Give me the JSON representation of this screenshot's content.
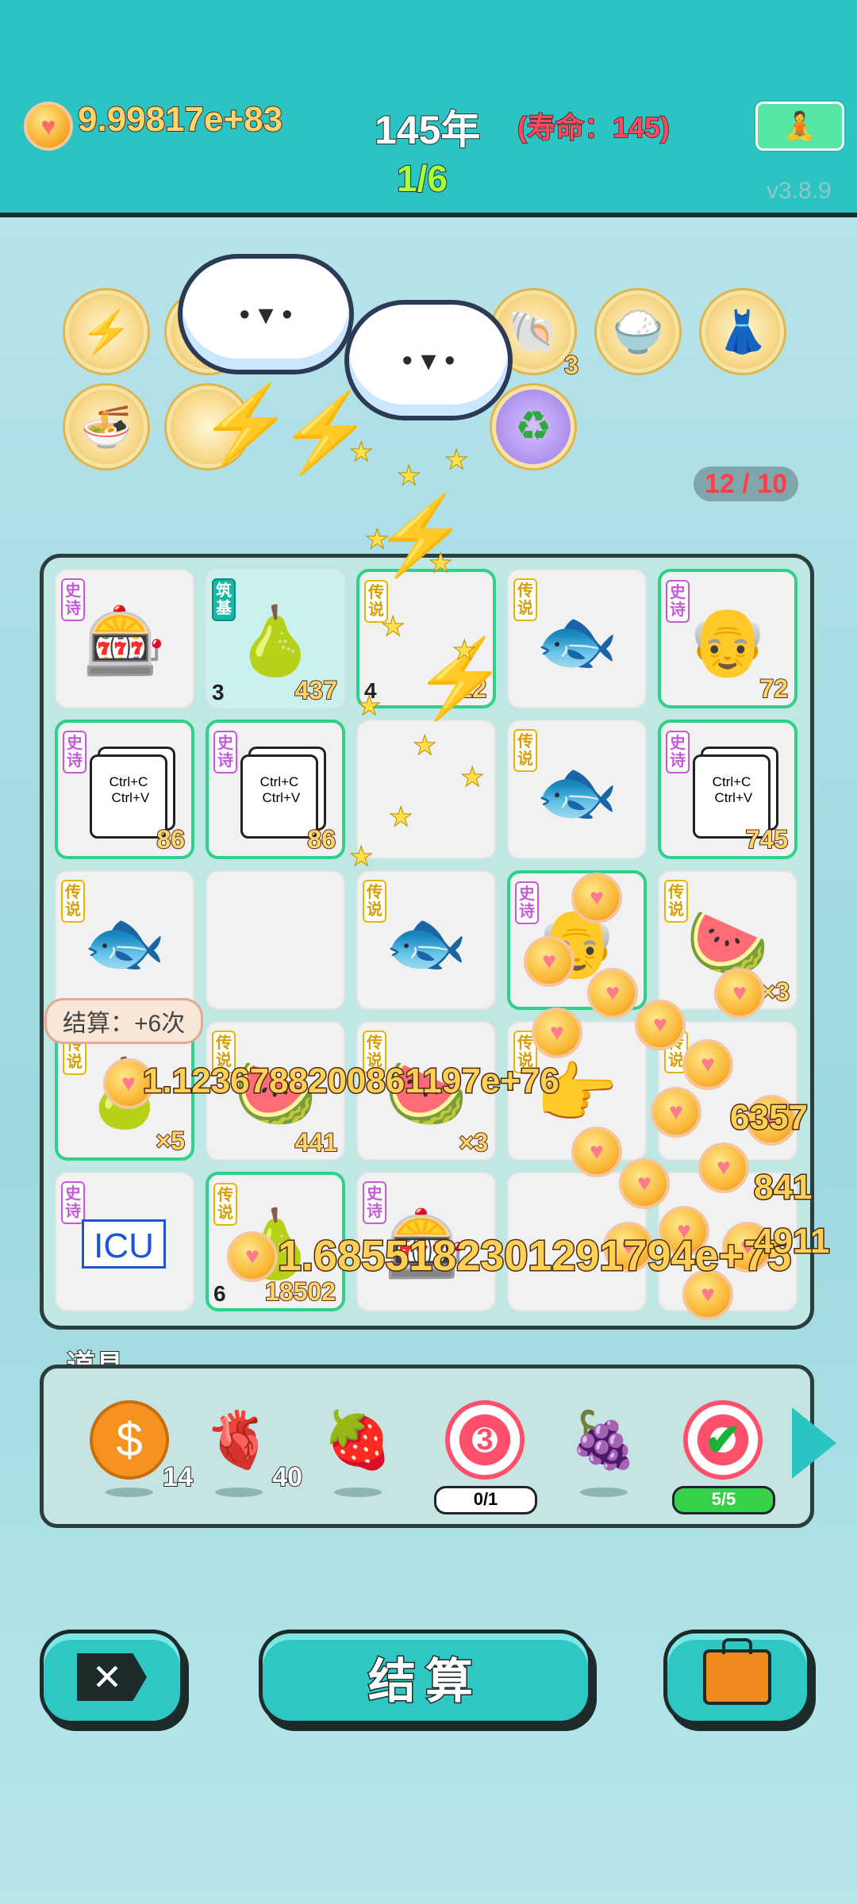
{
  "header": {
    "money": "9.99817e+83",
    "year": "145年",
    "lifespan": "(寿命：145)",
    "progress": "1/6",
    "version": "v3.8.9",
    "meditate_icon": "meditation-icon"
  },
  "buffs": {
    "row1": [
      {
        "icon": "lightning-icon",
        "glyph": "⚡",
        "count": ""
      },
      {
        "icon": "cloud-hidden-icon",
        "glyph": "",
        "count": ""
      },
      {
        "icon": "shell-icon",
        "glyph": "🐚",
        "count": "3"
      },
      {
        "icon": "rice-bowl-duo-icon",
        "glyph": "🍚",
        "count": ""
      },
      {
        "icon": "skirt-icon",
        "glyph": "👗",
        "count": ""
      }
    ],
    "row2": [
      {
        "icon": "rice-bowl-arrow-icon",
        "glyph": "🍜",
        "count": ""
      },
      {
        "icon": "recycle-icon",
        "glyph": "♻",
        "count": ""
      }
    ],
    "slots_counter": "12 / 10"
  },
  "board": {
    "cells": [
      {
        "tag": "史诗",
        "tag_style": "purple",
        "icon": "gacha-machine-icon",
        "glyph": "🎰",
        "value": "",
        "count": "",
        "style": "plain"
      },
      {
        "tag": "筑基",
        "tag_style": "teal",
        "icon": "longan-icon",
        "glyph": "🍐",
        "value": "437",
        "count": "3",
        "style": "teal"
      },
      {
        "tag": "传说",
        "tag_style": "yellow",
        "icon": "hidden-item-icon",
        "glyph": "",
        "value": "12",
        "count": "4",
        "style": "green"
      },
      {
        "tag": "传说",
        "tag_style": "yellow",
        "icon": "koi-fish-icon",
        "glyph": "🐟",
        "value": "",
        "count": "",
        "style": "plain"
      },
      {
        "tag": "史诗",
        "tag_style": "purple",
        "icon": "old-man-icon",
        "glyph": "👴",
        "value": "72",
        "count": "",
        "style": "green"
      },
      {
        "tag": "史诗",
        "tag_style": "purple",
        "icon": "ctrl-c-v-icon",
        "glyph": "",
        "value": "86",
        "count": "",
        "style": "green"
      },
      {
        "tag": "史诗",
        "tag_style": "purple",
        "icon": "ctrl-c-v-icon",
        "glyph": "",
        "value": "86",
        "count": "",
        "style": "green"
      },
      {
        "tag": "",
        "tag_style": "yellow",
        "icon": "hidden-item-icon",
        "glyph": "",
        "value": "",
        "count": "",
        "style": "plain"
      },
      {
        "tag": "传说",
        "tag_style": "yellow",
        "icon": "koi-fish-icon",
        "glyph": "🐟",
        "value": "",
        "count": "",
        "style": "plain"
      },
      {
        "tag": "史诗",
        "tag_style": "purple",
        "icon": "ctrl-c-v-icon",
        "glyph": "",
        "value": "745",
        "count": "",
        "style": "green"
      },
      {
        "tag": "传说",
        "tag_style": "yellow",
        "icon": "koi-fish-icon",
        "glyph": "🐟",
        "value": "",
        "count": "",
        "style": "plain"
      },
      {
        "tag": "",
        "tag_style": "yellow",
        "icon": "empty-slot",
        "glyph": "",
        "value": "",
        "count": "",
        "style": "plain"
      },
      {
        "tag": "传说",
        "tag_style": "yellow",
        "icon": "koi-fish-rainbow-icon",
        "glyph": "🐟",
        "value": "",
        "count": "",
        "style": "plain"
      },
      {
        "tag": "史诗",
        "tag_style": "purple",
        "icon": "old-man-icon",
        "glyph": "👴",
        "value": "",
        "count": "",
        "style": "green"
      },
      {
        "tag": "传说",
        "tag_style": "yellow",
        "icon": "watermelon-icon",
        "glyph": "🍉",
        "value": "×3",
        "count": "",
        "style": "plain"
      },
      {
        "tag": "传说",
        "tag_style": "yellow",
        "icon": "pear-icon",
        "glyph": "🍐",
        "value": "×5",
        "count": "",
        "style": "green"
      },
      {
        "tag": "传说",
        "tag_style": "yellow",
        "icon": "watermelon-icon",
        "glyph": "🍉",
        "value": "441",
        "count": "",
        "style": "plain"
      },
      {
        "tag": "传说",
        "tag_style": "yellow",
        "icon": "watermelon-icon",
        "glyph": "🍉",
        "value": "×3",
        "count": "",
        "style": "plain"
      },
      {
        "tag": "传说",
        "tag_style": "yellow",
        "icon": "pointer-hand-icon",
        "glyph": "👉",
        "value": "",
        "count": "",
        "style": "plain"
      },
      {
        "tag": "传说",
        "tag_style": "yellow",
        "icon": "hidden-item-icon",
        "glyph": "",
        "value": "",
        "count": "",
        "style": "plain"
      },
      {
        "tag": "史诗",
        "tag_style": "purple",
        "icon": "icu-icon",
        "glyph": "ICU",
        "value": "",
        "count": "",
        "style": "plain"
      },
      {
        "tag": "传说",
        "tag_style": "yellow",
        "icon": "pear-icon",
        "glyph": "🍐",
        "value": "18502",
        "count": "6",
        "style": "green"
      },
      {
        "tag": "史诗",
        "tag_style": "purple",
        "icon": "gacha-machine-icon",
        "glyph": "🎰",
        "value": "",
        "count": "",
        "style": "plain"
      },
      {
        "tag": "",
        "tag_style": "yellow",
        "icon": "empty-slot",
        "glyph": "",
        "value": "",
        "count": "",
        "style": "plain"
      },
      {
        "tag": "",
        "tag_style": "yellow",
        "icon": "hidden-item-icon",
        "glyph": "",
        "value": "",
        "count": "",
        "style": "plain"
      }
    ]
  },
  "effects": {
    "tooltip": "结算：+6次",
    "float1": "1.1236788200861197e+76",
    "float2": "1.6855182301291794e+75",
    "float3": "6357",
    "float4": "841",
    "float5": "4911"
  },
  "props": {
    "title": "道具",
    "items": [
      {
        "icon": "dollar-coin-icon",
        "glyph": "$",
        "count": "14",
        "pill": ""
      },
      {
        "icon": "liver-icon",
        "glyph": "🫀",
        "count": "40",
        "pill": ""
      },
      {
        "icon": "strawberry-icon",
        "glyph": "🍓",
        "count": "",
        "pill": ""
      },
      {
        "icon": "target-3-icon",
        "glyph": "3",
        "count": "",
        "pill": "0/1"
      },
      {
        "icon": "bayberry-icon",
        "glyph": "🍇",
        "count": "",
        "pill": ""
      },
      {
        "icon": "target-check-icon",
        "glyph": "✔",
        "count": "",
        "pill": "5/5"
      }
    ]
  },
  "buttons": {
    "close_icon": "close-tag-icon",
    "settle_label": "结算",
    "bag_icon": "briefcase-icon"
  }
}
